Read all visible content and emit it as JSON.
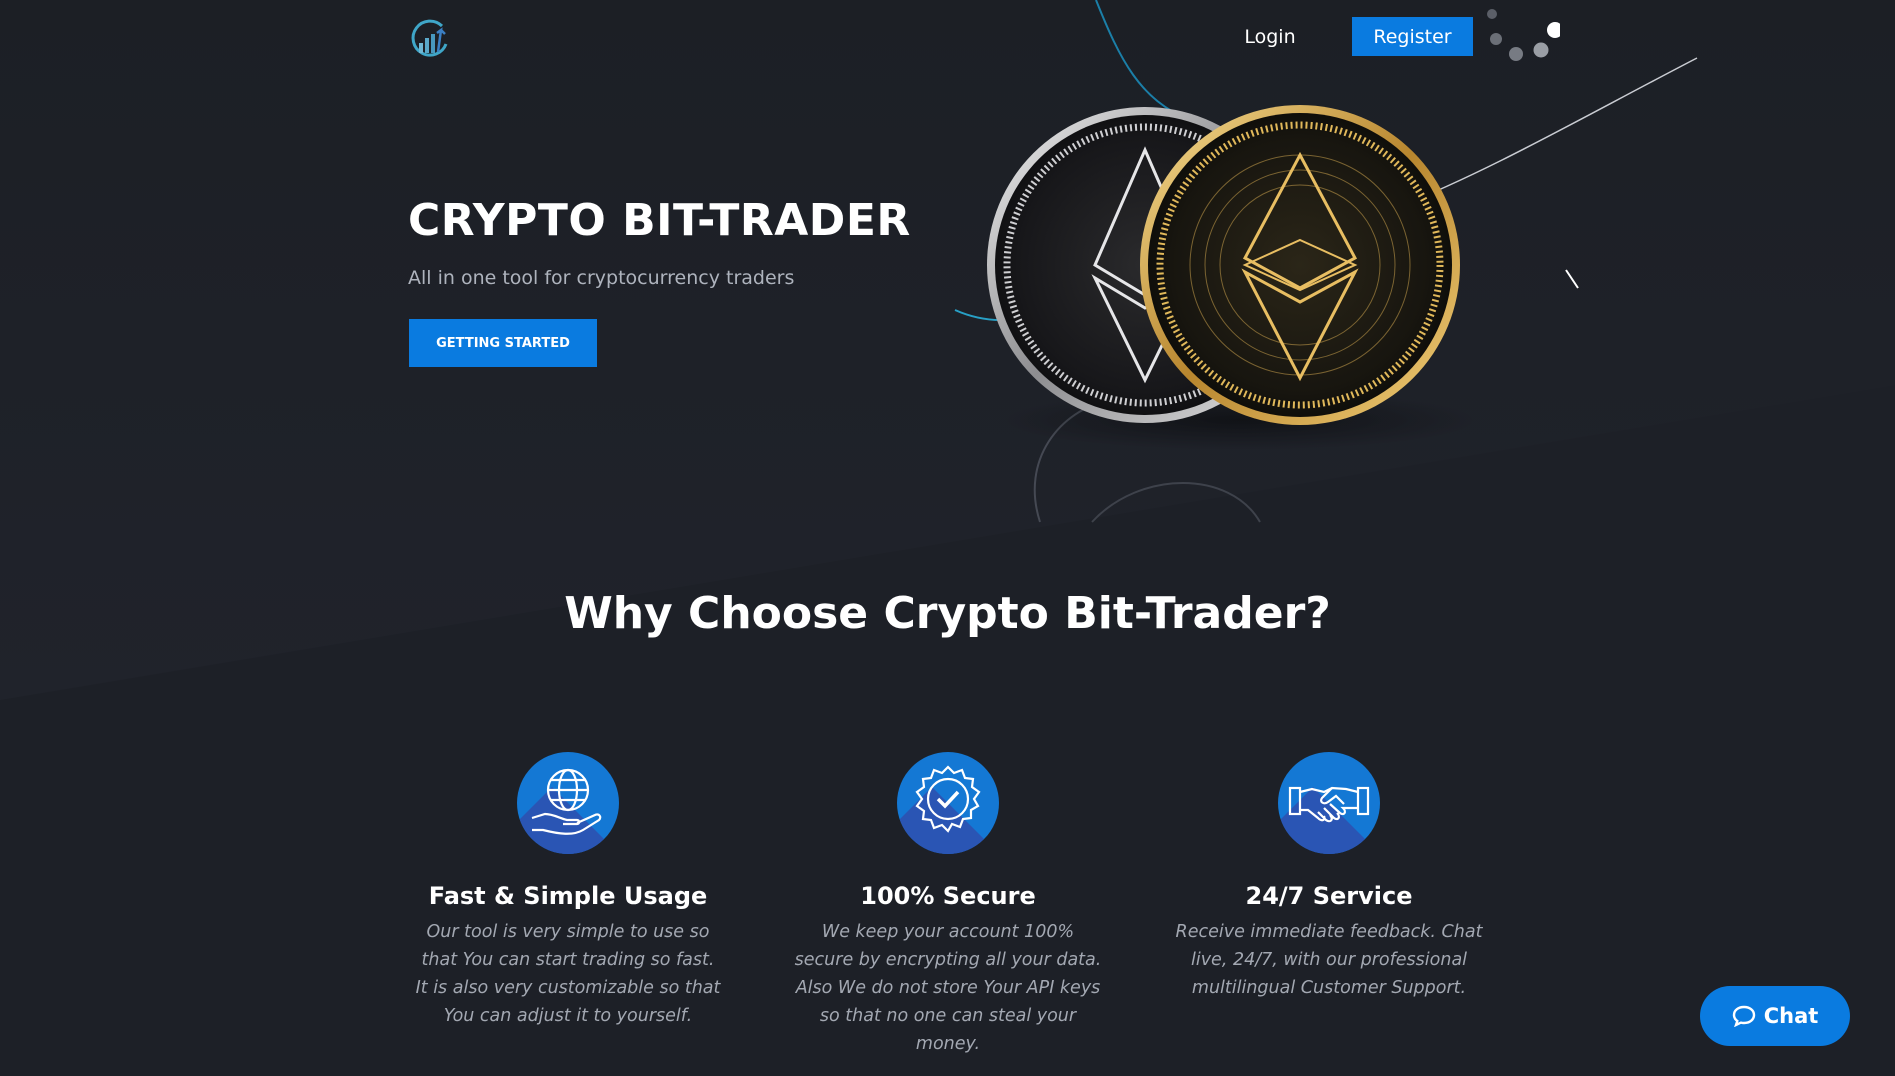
{
  "header": {
    "logo_icon": "chart-growth-logo-icon",
    "login_label": "Login",
    "register_label": "Register"
  },
  "hero": {
    "title": "CRYPTO BIT-TRADER",
    "subtitle": "All in one tool for cryptocurrency traders",
    "cta_label": "GETTING STARTED"
  },
  "section": {
    "title": "Why Choose Crypto Bit-Trader?"
  },
  "features": [
    {
      "icon": "globe-in-hand-icon",
      "title": "Fast & Simple Usage",
      "text": "Our tool is very simple to use so that You can start trading so fast. It is also very customizable so that You can adjust it to yourself."
    },
    {
      "icon": "verified-badge-icon",
      "title": "100% Secure",
      "text": "We keep your account 100% secure by encrypting all your data. Also We do not store Your API keys so that no one can steal your money."
    },
    {
      "icon": "handshake-icon",
      "title": "24/7 Service",
      "text": "Receive immediate feedback. Chat live, 24/7, with our professional multilingual Customer Support."
    }
  ],
  "chat": {
    "label": "Chat",
    "icon": "chat-bubble-icon"
  },
  "colors": {
    "background": "#1d2027",
    "accent": "#0a7be0",
    "muted_text": "#aeb3bd"
  }
}
